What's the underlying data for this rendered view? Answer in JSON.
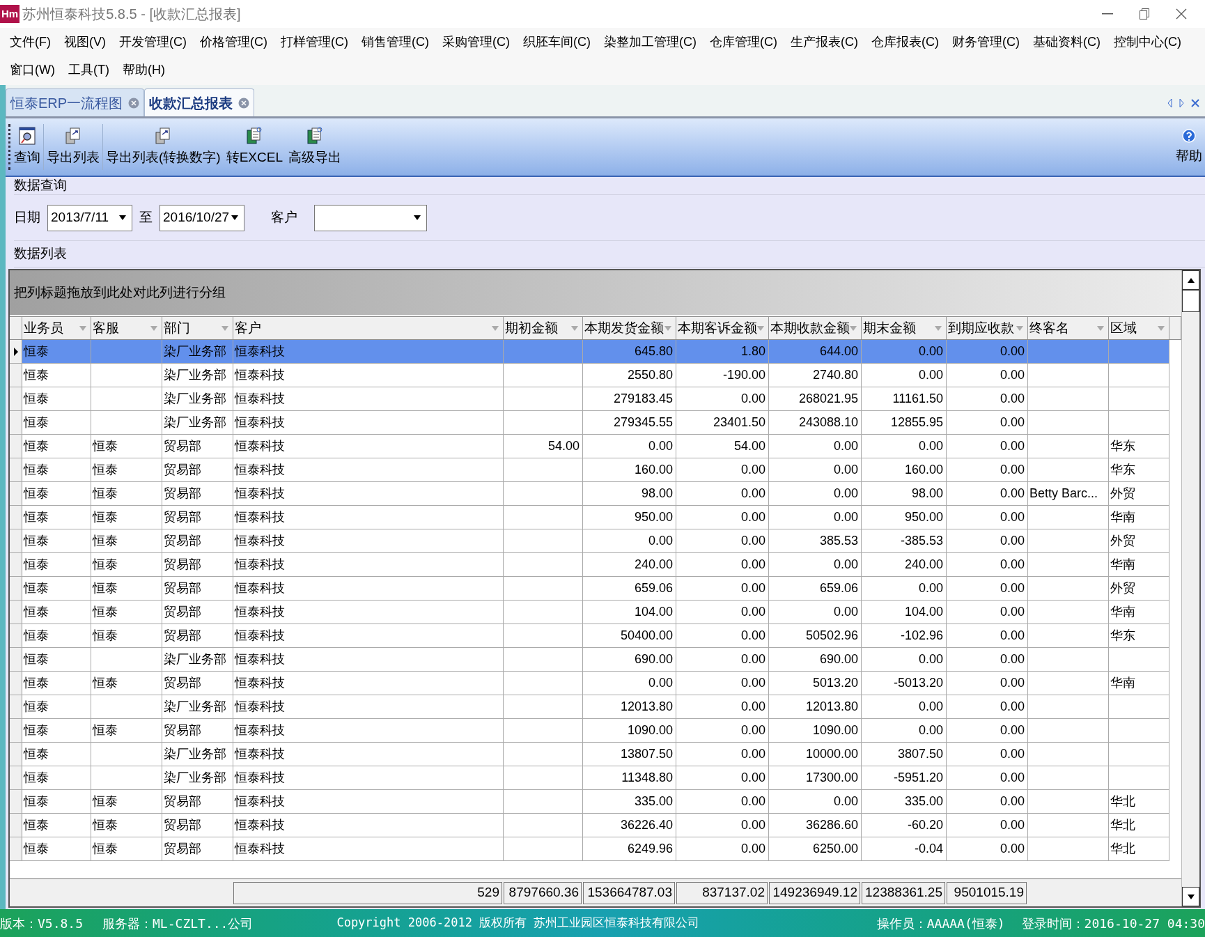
{
  "window": {
    "logo": "Hm",
    "title": "苏州恒泰科技5.8.5 - [收款汇总报表]"
  },
  "menu_rows": [
    [
      "文件(F)",
      "视图(V)",
      "开发管理(C)",
      "价格管理(C)",
      "打样管理(C)",
      "销售管理(C)",
      "采购管理(C)",
      "织胚车间(C)",
      "染整加工管理(C)",
      "仓库管理(C)",
      "生产报表(C)",
      "仓库报表(C)",
      "财务管理(C)",
      "基础资料(C)",
      "控制中心(C)"
    ],
    [
      "窗口(W)",
      "工具(T)",
      "帮助(H)"
    ]
  ],
  "tabs": [
    {
      "label": "恒泰ERP一流程图",
      "selected": false
    },
    {
      "label": "收款汇总报表",
      "selected": true
    }
  ],
  "toolbar": {
    "buttons": [
      {
        "label": "查询",
        "kind": "search"
      },
      {
        "label": "导出列表",
        "kind": "export"
      },
      {
        "label": "导出列表(转换数字)",
        "kind": "export"
      },
      {
        "label": "转EXCEL",
        "kind": "excel"
      },
      {
        "label": "高级导出",
        "kind": "excel"
      }
    ],
    "help": "帮助"
  },
  "query": {
    "title": "数据查询",
    "date_label": "日期",
    "date_from": "2013/7/11",
    "to_label": "至",
    "date_to": "2016/10/27",
    "customer_label": "客户"
  },
  "list_title": "数据列表",
  "grid": {
    "group_hint": "把列标题拖放到此处对此列进行分组",
    "columns": [
      "业务员",
      "客服",
      "部门",
      "客户",
      "期初金额",
      "本期发货金额",
      "本期客诉金额",
      "本期收款金额",
      "期末金额",
      "到期应收款",
      "终客名",
      "区域"
    ],
    "rows": [
      {
        "selected": true,
        "cells": [
          "恒泰",
          null,
          "染厂业务部",
          "恒泰科技",
          null,
          "645.80",
          "1.80",
          "644.00",
          "0.00",
          "0.00",
          null,
          null
        ]
      },
      {
        "selected": false,
        "cells": [
          "恒泰",
          null,
          "染厂业务部",
          "恒泰科技",
          null,
          "2550.80",
          "-190.00",
          "2740.80",
          "0.00",
          "0.00",
          null,
          null
        ]
      },
      {
        "selected": false,
        "cells": [
          "恒泰",
          null,
          "染厂业务部",
          "恒泰科技",
          null,
          "279183.45",
          "0.00",
          "268021.95",
          "11161.50",
          "0.00",
          null,
          null
        ]
      },
      {
        "selected": false,
        "cells": [
          "恒泰",
          null,
          "染厂业务部",
          "恒泰科技",
          null,
          "279345.55",
          "23401.50",
          "243088.10",
          "12855.95",
          "0.00",
          null,
          null
        ]
      },
      {
        "selected": false,
        "cells": [
          "恒泰",
          "恒泰",
          "贸易部",
          "恒泰科技",
          "54.00",
          "0.00",
          "54.00",
          "0.00",
          "0.00",
          "0.00",
          null,
          "华东"
        ]
      },
      {
        "selected": false,
        "cells": [
          "恒泰",
          "恒泰",
          "贸易部",
          "恒泰科技",
          null,
          "160.00",
          "0.00",
          "0.00",
          "160.00",
          "0.00",
          null,
          "华东"
        ]
      },
      {
        "selected": false,
        "cells": [
          "恒泰",
          "恒泰",
          "贸易部",
          "恒泰科技",
          null,
          "98.00",
          "0.00",
          "0.00",
          "98.00",
          "0.00",
          "Betty Barc...",
          "外贸"
        ]
      },
      {
        "selected": false,
        "cells": [
          "恒泰",
          "恒泰",
          "贸易部",
          "恒泰科技",
          null,
          "950.00",
          "0.00",
          "0.00",
          "950.00",
          "0.00",
          null,
          "华南"
        ]
      },
      {
        "selected": false,
        "cells": [
          "恒泰",
          "恒泰",
          "贸易部",
          "恒泰科技",
          null,
          "0.00",
          "0.00",
          "385.53",
          "-385.53",
          "0.00",
          null,
          "外贸"
        ]
      },
      {
        "selected": false,
        "cells": [
          "恒泰",
          "恒泰",
          "贸易部",
          "恒泰科技",
          null,
          "240.00",
          "0.00",
          "0.00",
          "240.00",
          "0.00",
          null,
          "华南"
        ]
      },
      {
        "selected": false,
        "cells": [
          "恒泰",
          "恒泰",
          "贸易部",
          "恒泰科技",
          null,
          "659.06",
          "0.00",
          "659.06",
          "0.00",
          "0.00",
          null,
          "外贸"
        ]
      },
      {
        "selected": false,
        "cells": [
          "恒泰",
          "恒泰",
          "贸易部",
          "恒泰科技",
          null,
          "104.00",
          "0.00",
          "0.00",
          "104.00",
          "0.00",
          null,
          "华南"
        ]
      },
      {
        "selected": false,
        "cells": [
          "恒泰",
          "恒泰",
          "贸易部",
          "恒泰科技",
          null,
          "50400.00",
          "0.00",
          "50502.96",
          "-102.96",
          "0.00",
          null,
          "华东"
        ]
      },
      {
        "selected": false,
        "cells": [
          "恒泰",
          null,
          "染厂业务部",
          "恒泰科技",
          null,
          "690.00",
          "0.00",
          "690.00",
          "0.00",
          "0.00",
          null,
          null
        ]
      },
      {
        "selected": false,
        "cells": [
          "恒泰",
          "恒泰",
          "贸易部",
          "恒泰科技",
          null,
          "0.00",
          "0.00",
          "5013.20",
          "-5013.20",
          "0.00",
          null,
          "华南"
        ]
      },
      {
        "selected": false,
        "cells": [
          "恒泰",
          null,
          "染厂业务部",
          "恒泰科技",
          null,
          "12013.80",
          "0.00",
          "12013.80",
          "0.00",
          "0.00",
          null,
          null
        ]
      },
      {
        "selected": false,
        "cells": [
          "恒泰",
          "恒泰",
          "贸易部",
          "恒泰科技",
          null,
          "1090.00",
          "0.00",
          "1090.00",
          "0.00",
          "0.00",
          null,
          null
        ]
      },
      {
        "selected": false,
        "cells": [
          "恒泰",
          null,
          "染厂业务部",
          "恒泰科技",
          null,
          "13807.50",
          "0.00",
          "10000.00",
          "3807.50",
          "0.00",
          null,
          null
        ]
      },
      {
        "selected": false,
        "cells": [
          "恒泰",
          null,
          "染厂业务部",
          "恒泰科技",
          null,
          "11348.80",
          "0.00",
          "17300.00",
          "-5951.20",
          "0.00",
          null,
          null
        ]
      },
      {
        "selected": false,
        "cells": [
          "恒泰",
          "恒泰",
          "贸易部",
          "恒泰科技",
          null,
          "335.00",
          "0.00",
          "0.00",
          "335.00",
          "0.00",
          null,
          "华北"
        ]
      },
      {
        "selected": false,
        "cells": [
          "恒泰",
          "恒泰",
          "贸易部",
          "恒泰科技",
          null,
          "36226.40",
          "0.00",
          "36286.60",
          "-60.20",
          "0.00",
          null,
          "华北"
        ]
      },
      {
        "selected": false,
        "cells": [
          "恒泰",
          "恒泰",
          "贸易部",
          "恒泰科技",
          null,
          "6249.96",
          "0.00",
          "6250.00",
          "-0.04",
          "0.00",
          null,
          "华北"
        ]
      }
    ],
    "totals": [
      "529",
      "8797660.36",
      "153664787.03",
      "837137.02",
      "149236949.12",
      "12388361.25",
      "9501015.19"
    ]
  },
  "status_bar": {
    "version": "版本：V5.8.5",
    "server": "服务器：ML-CZLT...公司",
    "copyright": "Copyright 2006-2012 版权所有  苏州工业园区恒泰科技有限公司",
    "operator": "操作员：AAAAA(恒泰)",
    "login_time": "登录时间：2016-10-27 04:30"
  }
}
